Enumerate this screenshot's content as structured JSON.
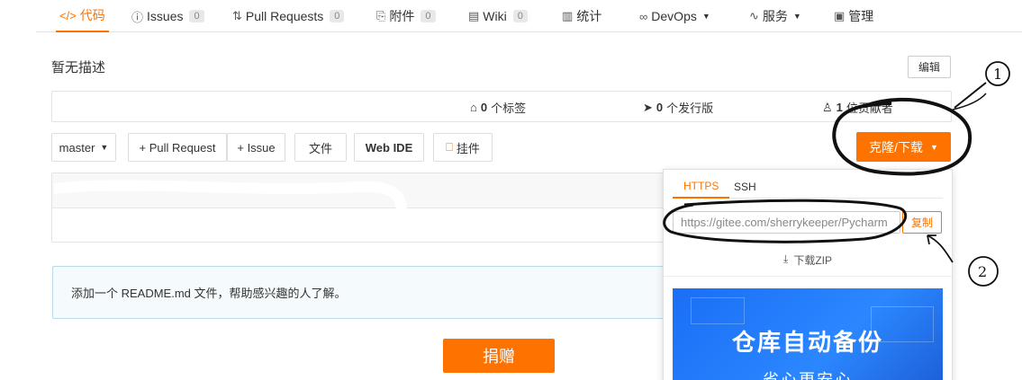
{
  "nav": {
    "tabs": [
      {
        "icon": "</>",
        "label": "代码"
      },
      {
        "icon": "ⓘ",
        "label": "Issues",
        "count": "0"
      },
      {
        "icon": "⇅",
        "label": "Pull Requests",
        "count": "0"
      },
      {
        "icon": "⎘",
        "label": "附件",
        "count": "0"
      },
      {
        "icon": "▤",
        "label": "Wiki",
        "count": "0"
      },
      {
        "icon": "▥",
        "label": "统计"
      },
      {
        "icon": "∞",
        "label": "DevOps"
      },
      {
        "icon": "∿",
        "label": "服务"
      },
      {
        "icon": "▣",
        "label": "管理"
      }
    ]
  },
  "repo": {
    "description": "暂无描述",
    "edit_label": "编辑",
    "stats": {
      "tags_count": "0",
      "tags_label": "个标签",
      "releases_count": "0",
      "releases_label": "个发行版",
      "contributors_count": "1",
      "contributors_label": "位贡献者"
    }
  },
  "toolbar": {
    "branch": "master",
    "pull_request": "+ Pull Request",
    "issue": "+ Issue",
    "file": "文件",
    "web_ide": "Web IDE",
    "widget": "挂件",
    "clone": "克隆/下载"
  },
  "readme_notice": "添加一个 README.md 文件，帮助感兴趣的人了解。",
  "donate_label": "捐赠",
  "clone_panel": {
    "tab_https": "HTTPS",
    "tab_ssh": "SSH",
    "url": "https://gitee.com/sherrykeeper/Pycharm",
    "copy_label": "复制",
    "zip_label": "下载ZIP",
    "banner_title": "仓库自动备份",
    "banner_subtitle": "省心更安心"
  },
  "annotations": {
    "mark_1": "1",
    "mark_2": "2"
  },
  "colors": {
    "accent": "#fe7300",
    "banner_blue": "#1a6ef5"
  }
}
